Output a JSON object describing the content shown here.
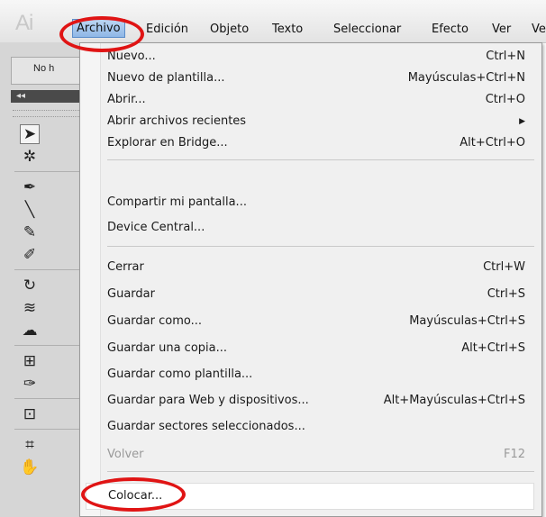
{
  "app": {
    "logo": "Ai",
    "control_strip": "No h",
    "panel_header": "◂◂"
  },
  "menubar": {
    "items": [
      "Archivo",
      "Edición",
      "Objeto",
      "Texto",
      "Seleccionar",
      "Efecto",
      "Ver",
      "Ve"
    ]
  },
  "tools": [
    "selection-tool-icon",
    "magic-wand-icon",
    "pen-tool-icon",
    "line-tool-icon",
    "paintbrush-icon",
    "blob-brush-icon",
    "rotate-tool-icon",
    "warp-tool-icon",
    "symbol-sprayer-icon",
    "mesh-tool-icon",
    "eyedropper-icon",
    "live-paint-icon",
    "artboard-tool-icon",
    "hand-tool-icon"
  ],
  "menu": {
    "items": [
      {
        "label": "Nuevo...",
        "shortcut": "Ctrl+N"
      },
      {
        "label": "Nuevo de plantilla...",
        "shortcut": "Mayúsculas+Ctrl+N"
      },
      {
        "label": "Abrir...",
        "shortcut": "Ctrl+O"
      },
      {
        "label": "Abrir archivos recientes",
        "shortcut": ""
      },
      {
        "label": "Explorar en Bridge...",
        "shortcut": "Alt+Ctrl+O"
      },
      {
        "label": "Compartir mi pantalla...",
        "shortcut": ""
      },
      {
        "label": "Device Central...",
        "shortcut": ""
      },
      {
        "label": "Cerrar",
        "shortcut": "Ctrl+W"
      },
      {
        "label": "Guardar",
        "shortcut": "Ctrl+S"
      },
      {
        "label": "Guardar como...",
        "shortcut": "Mayúsculas+Ctrl+S"
      },
      {
        "label": "Guardar una copia...",
        "shortcut": "Alt+Ctrl+S"
      },
      {
        "label": "Guardar como plantilla...",
        "shortcut": ""
      },
      {
        "label": "Guardar para Web y dispositivos...",
        "shortcut": "Alt+Mayúsculas+Ctrl+S"
      },
      {
        "label": "Guardar sectores seleccionados...",
        "shortcut": ""
      },
      {
        "label": "Volver",
        "shortcut": "F12"
      },
      {
        "label": "Colocar...",
        "shortcut": ""
      }
    ]
  },
  "colors": {
    "annotation": "#e01414",
    "menu_bg": "#f0f0f0",
    "active_menu": "#8fb7e6"
  }
}
